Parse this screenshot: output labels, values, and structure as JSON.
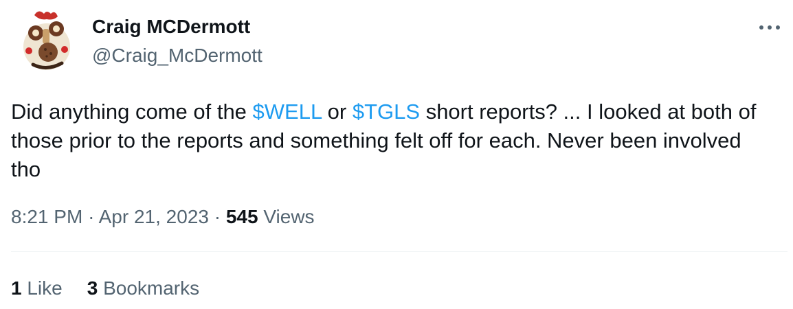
{
  "author": {
    "display_name": "Craig MCDermott",
    "handle": "@Craig_McDermott"
  },
  "tweet": {
    "text_part1": "Did anything come of the ",
    "cashtag1": "$WELL",
    "text_part2": " or ",
    "cashtag2": "$TGLS",
    "text_part3": " short reports? ... I looked at both of those prior to the reports and something felt off for each. Never been involved tho"
  },
  "meta": {
    "time": "8:21 PM",
    "separator": "·",
    "date": "Apr 21, 2023",
    "views_count": "545",
    "views_label": "Views"
  },
  "stats": {
    "likes_count": "1",
    "likes_label": "Like",
    "bookmarks_count": "3",
    "bookmarks_label": "Bookmarks"
  },
  "icons": {
    "more": "more-horizontal-icon"
  },
  "colors": {
    "text_primary": "#0f1419",
    "text_secondary": "#536471",
    "link": "#1d9bf0",
    "divider": "#eff3f4"
  }
}
